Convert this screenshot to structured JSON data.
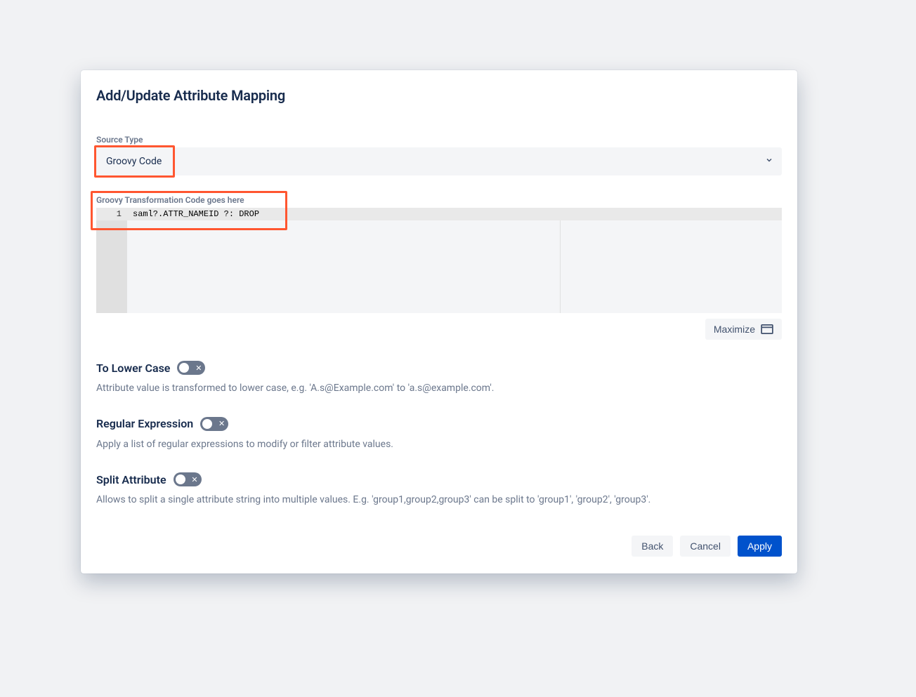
{
  "modal": {
    "title": "Add/Update Attribute Mapping"
  },
  "sourceType": {
    "label": "Source Type",
    "value": "Groovy Code"
  },
  "codeEditor": {
    "label": "Groovy Transformation Code goes here",
    "lineNumber": "1",
    "code": "saml?.ATTR_NAMEID ?: DROP"
  },
  "maximize": {
    "label": "Maximize"
  },
  "toggles": {
    "toLowerCase": {
      "label": "To Lower Case",
      "desc": "Attribute value is transformed to lower case, e.g. 'A.s@Example.com' to 'a.s@example.com'.",
      "value": false
    },
    "regex": {
      "label": "Regular Expression",
      "desc": "Apply a list of regular expressions to modify or filter attribute values.",
      "value": false
    },
    "split": {
      "label": "Split Attribute",
      "desc": "Allows to split a single attribute string into multiple values. E.g. 'group1,group2,group3' can be split to 'group1', 'group2', 'group3'.",
      "value": false
    }
  },
  "footer": {
    "back": "Back",
    "cancel": "Cancel",
    "apply": "Apply"
  }
}
